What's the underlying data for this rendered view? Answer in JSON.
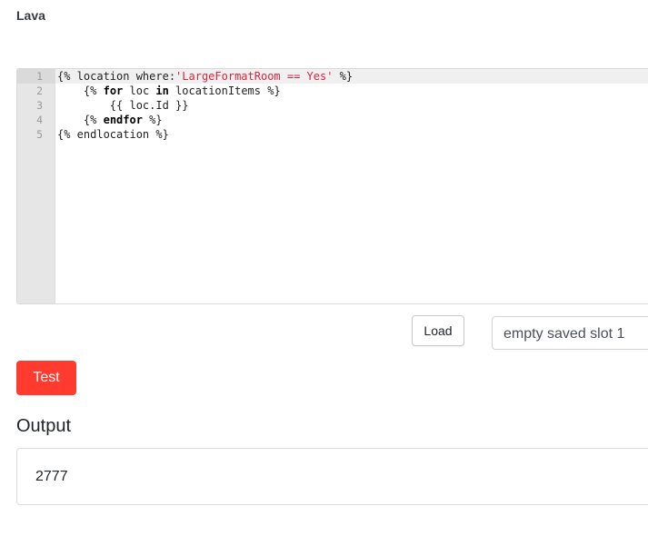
{
  "section": {
    "label": "Lava"
  },
  "editor": {
    "line_numbers": [
      "1",
      "2",
      "3",
      "4",
      "5"
    ],
    "lines": [
      {
        "indent": "",
        "pre": "{% location where:",
        "str": "'LargeFormatRoom == Yes'",
        "post": " %}"
      },
      {
        "indent": "    ",
        "pre": "{% ",
        "kw1": "for",
        "mid": " loc ",
        "kw2": "in",
        "post": " locationItems %}"
      },
      {
        "indent": "        ",
        "text": "{{ loc.Id }}"
      },
      {
        "indent": "    ",
        "pre": "{% ",
        "kw1": "endfor",
        "post": " %}"
      },
      {
        "indent": "",
        "text": "{% endlocation %}"
      }
    ]
  },
  "controls": {
    "load_label": "Load",
    "slot_value": "empty saved slot 1",
    "test_label": "Test"
  },
  "output": {
    "heading": "Output",
    "value": "2777"
  },
  "colors": {
    "test_button": "#ff3b30",
    "string_token": "#d7263d"
  }
}
